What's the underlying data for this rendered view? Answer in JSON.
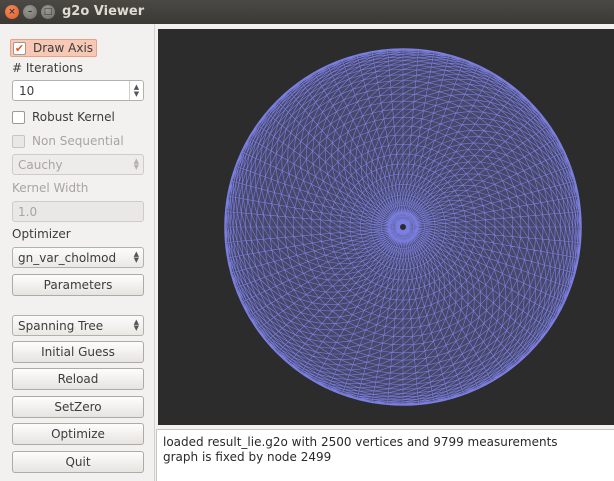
{
  "window": {
    "title": "g2o Viewer"
  },
  "sidebar": {
    "draw_axis": {
      "label": "Draw Axis",
      "checked": true
    },
    "iterations": {
      "label": "# Iterations",
      "value": "10"
    },
    "robust_kernel": {
      "label": "Robust Kernel",
      "checked": false
    },
    "non_sequential": {
      "label": "Non Sequential",
      "checked": false
    },
    "kernel_type": {
      "value": "Cauchy"
    },
    "kernel_width": {
      "label": "Kernel Width",
      "value": "1.0"
    },
    "optimizer": {
      "label": "Optimizer",
      "value": "gn_var_cholmod"
    },
    "buttons": {
      "parameters": "Parameters",
      "initialization": "Spanning Tree",
      "initial_guess": "Initial Guess",
      "reload": "Reload",
      "set_zero": "SetZero",
      "optimize": "Optimize",
      "quit": "Quit"
    }
  },
  "log": {
    "lines": [
      "loaded result_lie.g2o with 2500 vertices and 9799 measurements",
      "graph is fixed by node 2499"
    ]
  },
  "colors": {
    "graph_edges": "#7b7fe0",
    "viewer_background": "#2c2c2c",
    "accent": "#e05a22"
  }
}
